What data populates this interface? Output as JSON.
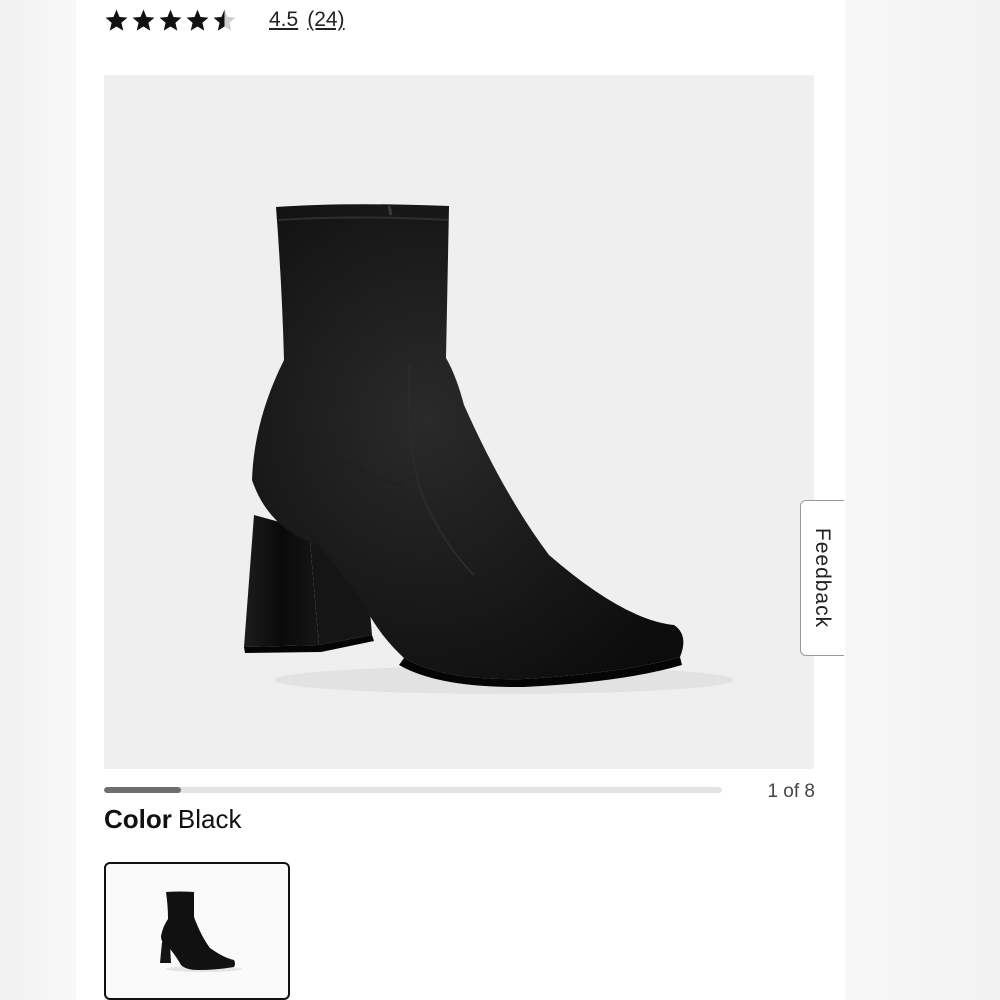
{
  "rating": {
    "value": "4.5",
    "count": "(24)",
    "stars": 4.5,
    "max_stars": 5,
    "star_color": "#111111",
    "star_empty_color": "#cfcfcf"
  },
  "gallery": {
    "image": "black-suede-ankle-boot",
    "background": "#efefef",
    "counter": "1 of 8",
    "current": 1,
    "total": 8
  },
  "feedback": {
    "label": "Feedback"
  },
  "color": {
    "label": "Color",
    "value": "Black",
    "swatches": [
      "black-suede-ankle-boot"
    ]
  }
}
